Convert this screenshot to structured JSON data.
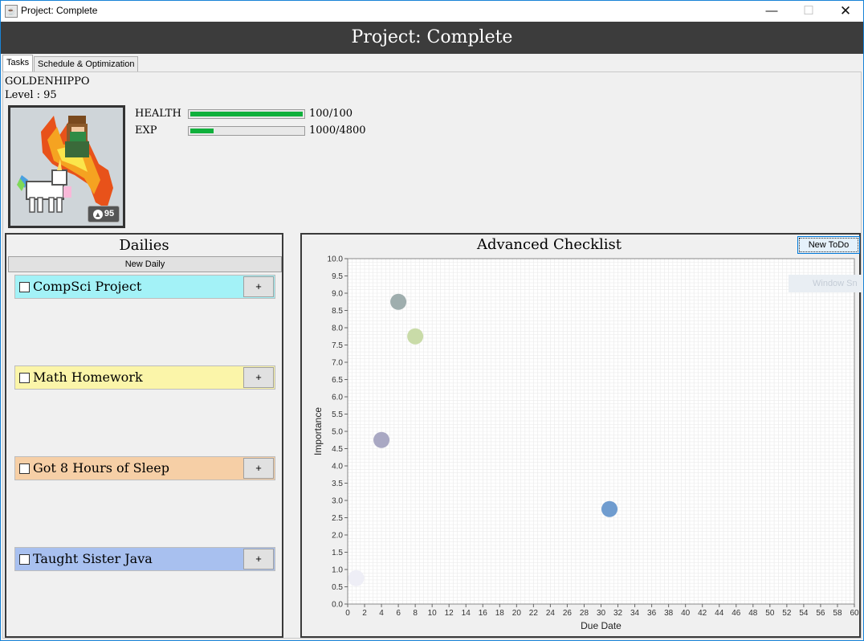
{
  "window": {
    "title": "Project: Complete",
    "minimize_glyph": "—",
    "maximize_glyph": "☐",
    "close_glyph": "✕",
    "app_icon": "java-icon"
  },
  "banner": {
    "title": "Project: Complete"
  },
  "tabs": [
    {
      "label": "Tasks",
      "active": true
    },
    {
      "label": "Schedule & Optimization",
      "active": false
    }
  ],
  "profile": {
    "username": "GOLDENHIPPO",
    "level_text": "Level : 95",
    "badge_level": "95"
  },
  "stats": {
    "health": {
      "label": "HEALTH",
      "value_text": "100/100",
      "fraction": 1.0,
      "color": "#10b03c"
    },
    "exp": {
      "label": "EXP",
      "value_text": "1000/4800",
      "fraction": 0.2083,
      "color": "#10b03c"
    }
  },
  "dailies": {
    "title": "Dailies",
    "new_button": "New Daily",
    "items": [
      {
        "label": "CompSci Project",
        "color": "#a3f2f7",
        "plus": "+"
      },
      {
        "label": "Math Homework",
        "color": "#fbf5a9",
        "plus": "+"
      },
      {
        "label": "Got 8 Hours of Sleep",
        "color": "#f6cfa6",
        "plus": "+"
      },
      {
        "label": "Taught Sister Java",
        "color": "#a8c0ef",
        "plus": "+"
      }
    ]
  },
  "checklist": {
    "title": "Advanced Checklist",
    "new_button": "New ToDo",
    "ghost_text": "Window Sn"
  },
  "chart_data": {
    "type": "scatter",
    "xlabel": "Due Date",
    "ylabel": "Importance",
    "xlim": [
      0,
      60
    ],
    "ylim": [
      0,
      10
    ],
    "x_ticks": [
      0,
      2,
      4,
      6,
      8,
      10,
      12,
      14,
      16,
      18,
      20,
      22,
      24,
      26,
      28,
      30,
      32,
      34,
      36,
      38,
      40,
      42,
      44,
      46,
      48,
      50,
      52,
      54,
      56,
      58,
      60
    ],
    "y_ticks": [
      "0.0",
      "0.5",
      "1.0",
      "1.5",
      "2.0",
      "2.5",
      "3.0",
      "3.5",
      "4.0",
      "4.5",
      "5.0",
      "5.5",
      "6.0",
      "6.5",
      "7.0",
      "7.5",
      "8.0",
      "8.5",
      "9.0",
      "9.5",
      "10.0"
    ],
    "grid": true,
    "points": [
      {
        "x": 6,
        "y": 8.75,
        "color": "#9faeae"
      },
      {
        "x": 8,
        "y": 7.75,
        "color": "#c9dba8"
      },
      {
        "x": 4,
        "y": 4.75,
        "color": "#a9a8c3"
      },
      {
        "x": 31,
        "y": 2.75,
        "color": "#6f9ccf"
      },
      {
        "x": 1,
        "y": 0.75,
        "color": "#eeeef6"
      }
    ]
  }
}
